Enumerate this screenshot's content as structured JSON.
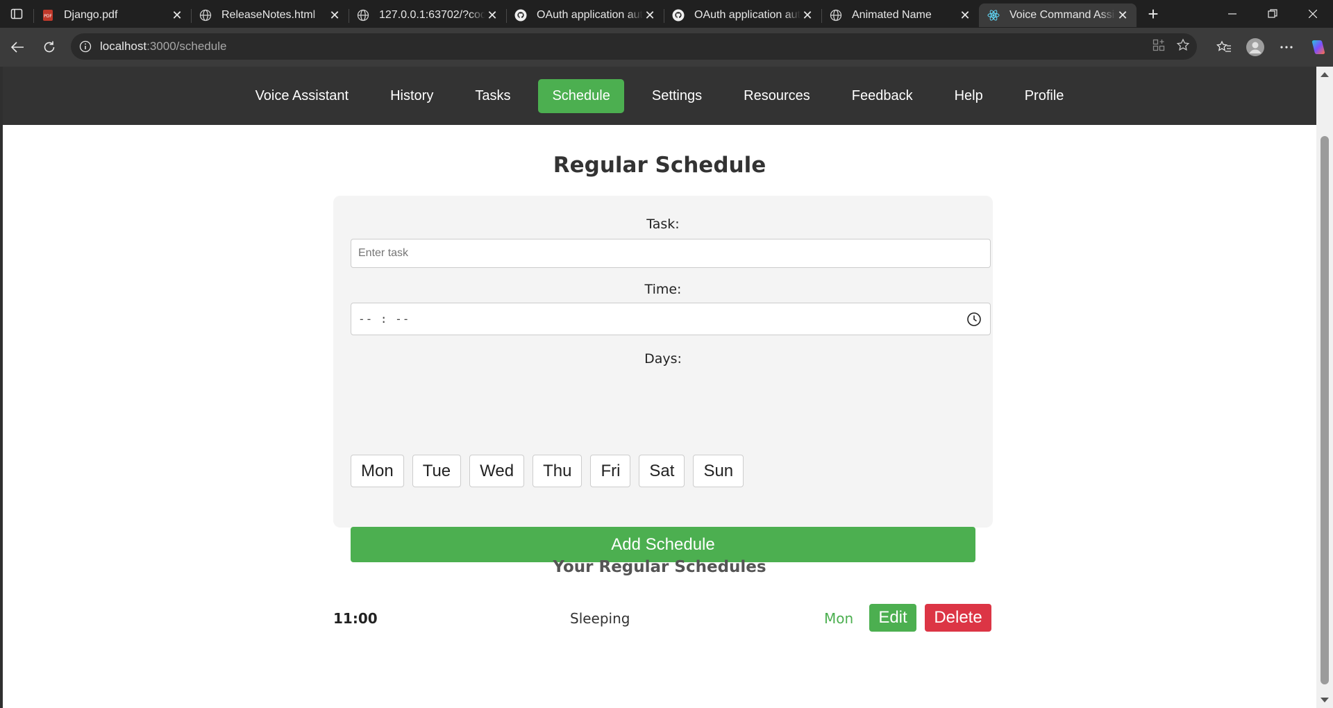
{
  "browser": {
    "tabs": [
      {
        "title": "Django.pdf",
        "icon": "pdf-icon",
        "active": false
      },
      {
        "title": "ReleaseNotes.html",
        "icon": "globe-icon",
        "active": false
      },
      {
        "title": "127.0.0.1:63702/?code=",
        "icon": "globe-icon",
        "active": false
      },
      {
        "title": "OAuth application auth",
        "icon": "github-icon",
        "active": false
      },
      {
        "title": "OAuth application auth",
        "icon": "github-icon",
        "active": false
      },
      {
        "title": "Animated Name",
        "icon": "globe-icon",
        "active": false
      },
      {
        "title": "Voice Command Assist",
        "icon": "react-icon",
        "active": true
      }
    ],
    "url_host": "localhost",
    "url_path": ":3000/schedule"
  },
  "nav": {
    "items": [
      "Voice Assistant",
      "History",
      "Tasks",
      "Schedule",
      "Settings",
      "Resources",
      "Feedback",
      "Help",
      "Profile"
    ],
    "active": "Schedule"
  },
  "page": {
    "title": "Regular Schedule"
  },
  "form": {
    "task_label": "Task:",
    "task_placeholder": "Enter task",
    "time_label": "Time:",
    "time_value": "-- : --",
    "days_label": "Days:",
    "days": [
      "Mon",
      "Tue",
      "Wed",
      "Thu",
      "Fri",
      "Sat",
      "Sun"
    ],
    "submit_label": "Add Schedule"
  },
  "schedules": {
    "title": "Your Regular Schedules",
    "items": [
      {
        "time": "11:00",
        "task": "Sleeping",
        "days": "Mon",
        "edit_label": "Edit",
        "delete_label": "Delete"
      }
    ]
  },
  "colors": {
    "accent": "#4caf50",
    "danger": "#dc3545",
    "navbar": "#333333"
  }
}
